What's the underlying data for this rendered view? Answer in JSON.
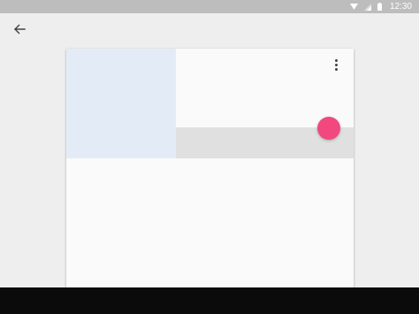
{
  "status_bar": {
    "time": "12:30",
    "icons": [
      "wifi-icon",
      "signal-icon",
      "battery-icon"
    ]
  },
  "toolbar": {
    "back_icon": "arrow-back-icon"
  },
  "card": {
    "overflow_icon": "more-vert-icon",
    "fab_icon": "fab"
  },
  "colors": {
    "accent": "#f0487f",
    "status_bar": "#bdbdbd",
    "background": "#eeeeee",
    "card": "#fafafa",
    "thumbnail": "#e3ecf6",
    "strip": "#e0e0e0",
    "nav_bar": "#0b0b0b"
  }
}
